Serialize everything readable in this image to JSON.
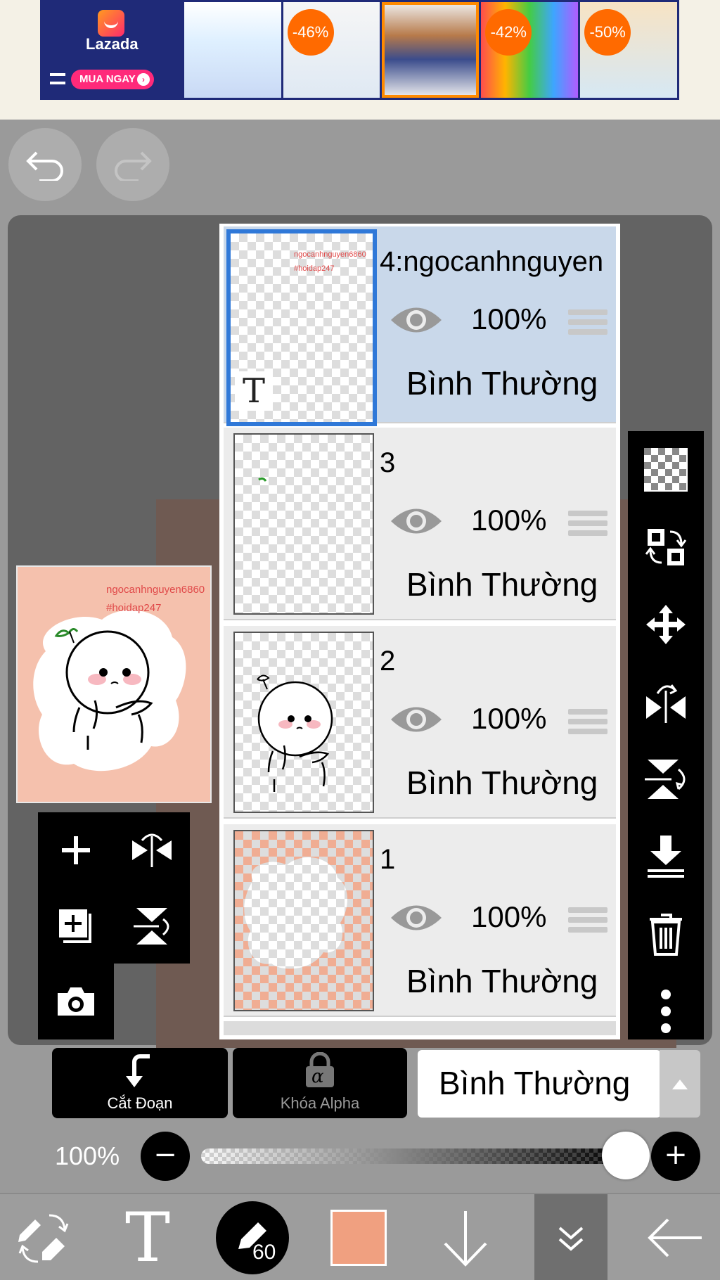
{
  "ad": {
    "brand": "Lazada",
    "cta": "MUA NGAY",
    "tiles": [
      {
        "discount": ""
      },
      {
        "discount": "-46%"
      },
      {
        "discount": ""
      },
      {
        "discount": "-42%"
      },
      {
        "discount": "-50%"
      }
    ]
  },
  "layers": [
    {
      "name": "4:ngocanhnguyen",
      "opacity": "100%",
      "blend": "Bình Thường",
      "thumb_marker": "T",
      "thumb_text1": "ngocanhnguyen6860",
      "thumb_text2": "#hoidap247"
    },
    {
      "name": "3",
      "opacity": "100%",
      "blend": "Bình Thường"
    },
    {
      "name": "2",
      "opacity": "100%",
      "blend": "Bình Thường"
    },
    {
      "name": "1",
      "opacity": "100%",
      "blend": "Bình Thường"
    }
  ],
  "preview": {
    "text1": "ngocanhnguyen6860",
    "text2": "#hoidap247"
  },
  "controls": {
    "clip_label": "Cắt Đoạn",
    "alpha_lock_label": "Khóa Alpha",
    "alpha_glyph": "α",
    "blend_mode": "Bình Thường",
    "opacity_label": "100%",
    "opacity_value": 1.0
  },
  "bottom_nav": {
    "text_tool_glyph": "T",
    "brush_size": "60",
    "color": "#f0a080"
  },
  "colors": {
    "selected_layer": "#c9d8ea",
    "selected_border": "#2f78d8",
    "canvas_bg": "#f5c1ad"
  }
}
